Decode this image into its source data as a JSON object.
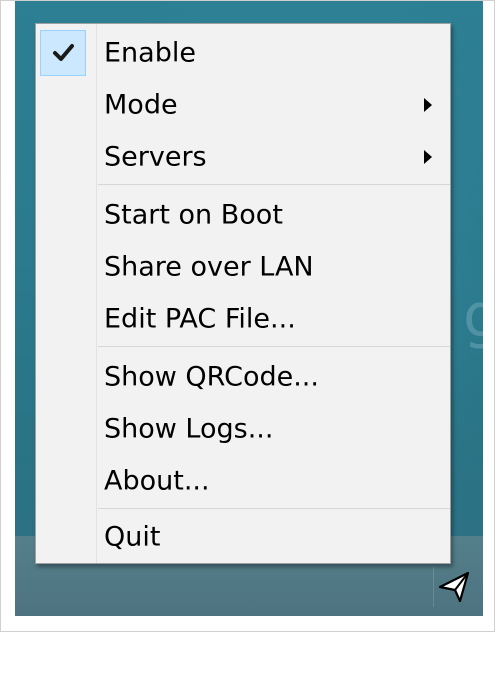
{
  "menu": {
    "items": [
      {
        "label": "Enable",
        "checked": true
      },
      {
        "label": "Mode",
        "submenu": true
      },
      {
        "label": "Servers",
        "submenu": true
      },
      {
        "label": "Start on Boot"
      },
      {
        "label": "Share over LAN"
      },
      {
        "label": "Edit PAC File..."
      },
      {
        "label": "Show QRCode..."
      },
      {
        "label": "Show Logs..."
      },
      {
        "label": "About..."
      },
      {
        "label": "Quit"
      }
    ]
  },
  "colors": {
    "menu_bg": "#f2f2f2",
    "check_highlight": "#cce8ff",
    "desktop": "#2b7a8e"
  },
  "icons": {
    "check": "check-icon",
    "submenu": "submenu-arrow-icon",
    "tray": "paper-plane-icon"
  }
}
